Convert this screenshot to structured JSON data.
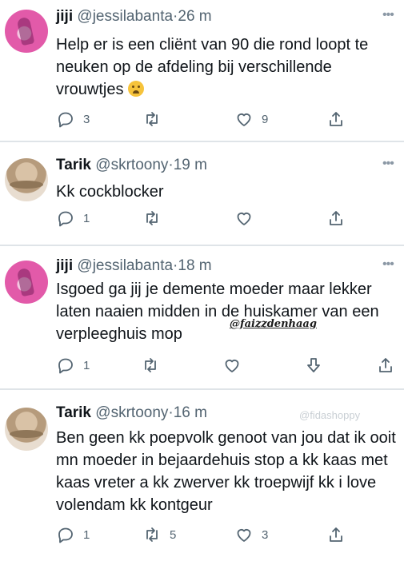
{
  "tweets": [
    {
      "name": "jiji",
      "handle": "@jessilabanta",
      "time": "26 m",
      "text": "Help er is een cliënt van 90 die rond loopt te neuken op de afdeling bij verschillende vrouwtjes",
      "emoji": "crying-face",
      "replies": "3",
      "retweets": "",
      "likes": "9"
    },
    {
      "name": "Tarik",
      "handle": "@skrtoony",
      "time": "19 m",
      "text": "Kk cockblocker",
      "replies": "1",
      "retweets": "",
      "likes": ""
    },
    {
      "name": "jiji",
      "handle": "@jessilabanta",
      "time": "18 m",
      "text": "Isgoed ga jij je demente moeder maar lekker laten naaien midden in de huiskamer van een verpleeghuis mop",
      "replies": "1",
      "retweets": "",
      "likes": ""
    },
    {
      "name": "Tarik",
      "handle": "@skrtoony",
      "time": "16 m",
      "text": "Ben geen kk poepvolk genoot van jou dat ik ooit mn moeder in bejaardehuis stop a kk kaas met kaas vreter a kk zwerver kk troepwijf kk i love volendam kk kontgeur",
      "replies": "1",
      "retweets": "5",
      "likes": "3"
    }
  ],
  "separator": "·",
  "more_glyph": "•••",
  "watermark": "@faizzdenhaag",
  "watermark_faint": "@fidashoppy",
  "colors": {
    "text": "#0f1419",
    "muted": "#536471",
    "divider": "#dfe4e8"
  }
}
